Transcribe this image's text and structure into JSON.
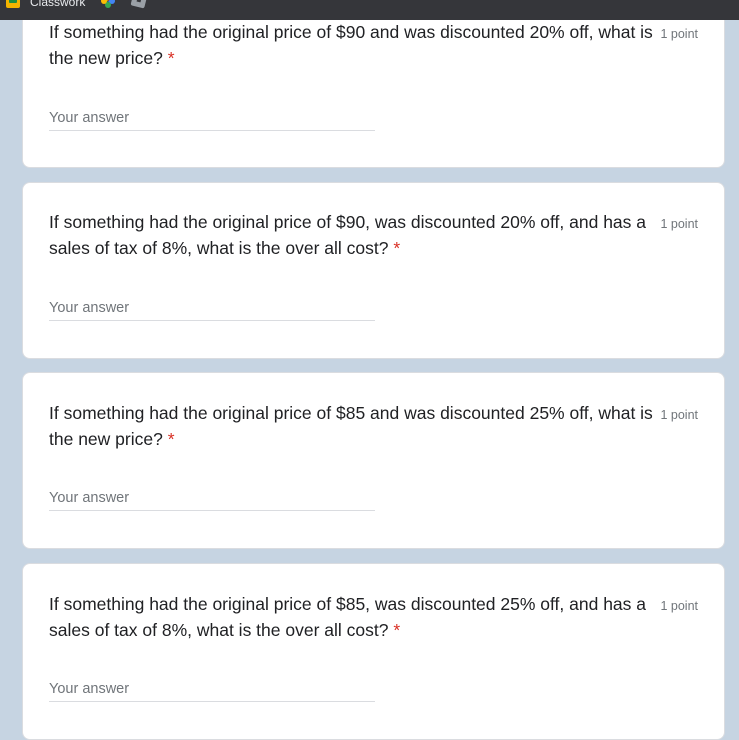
{
  "bookmarks_bar": {
    "items": [
      {
        "label": "Classwork",
        "icon": "classroom-icon"
      },
      {
        "label": "",
        "icon": "google-photos-icon"
      },
      {
        "label": "",
        "icon": "roblox-icon"
      }
    ]
  },
  "questions": [
    {
      "text": "If something had the original price of $90 and was discounted 20% off, what is the new price?",
      "required_marker": "*",
      "points": "1 point",
      "answer_value": "",
      "answer_placeholder": "Your answer"
    },
    {
      "text": "If something had the original price of $90, was discounted 20% off, and has a sales of tax of 8%, what is the over all cost?",
      "required_marker": "*",
      "points": "1 point",
      "answer_value": "",
      "answer_placeholder": "Your answer"
    },
    {
      "text": "If something had the original price of $85 and was discounted 25% off, what is the new price?",
      "required_marker": "*",
      "points": "1 point",
      "answer_value": "",
      "answer_placeholder": "Your answer"
    },
    {
      "text": "If something had the original price of $85, was discounted 25% off, and has a sales of tax of 8%, what is the over all cost?",
      "required_marker": "*",
      "points": "1 point",
      "answer_value": "",
      "answer_placeholder": "Your answer"
    }
  ],
  "colors": {
    "page_background": "#c6d4e2",
    "card_background": "#ffffff",
    "required": "#d93025",
    "bookmarks_bar": "#35363a"
  }
}
